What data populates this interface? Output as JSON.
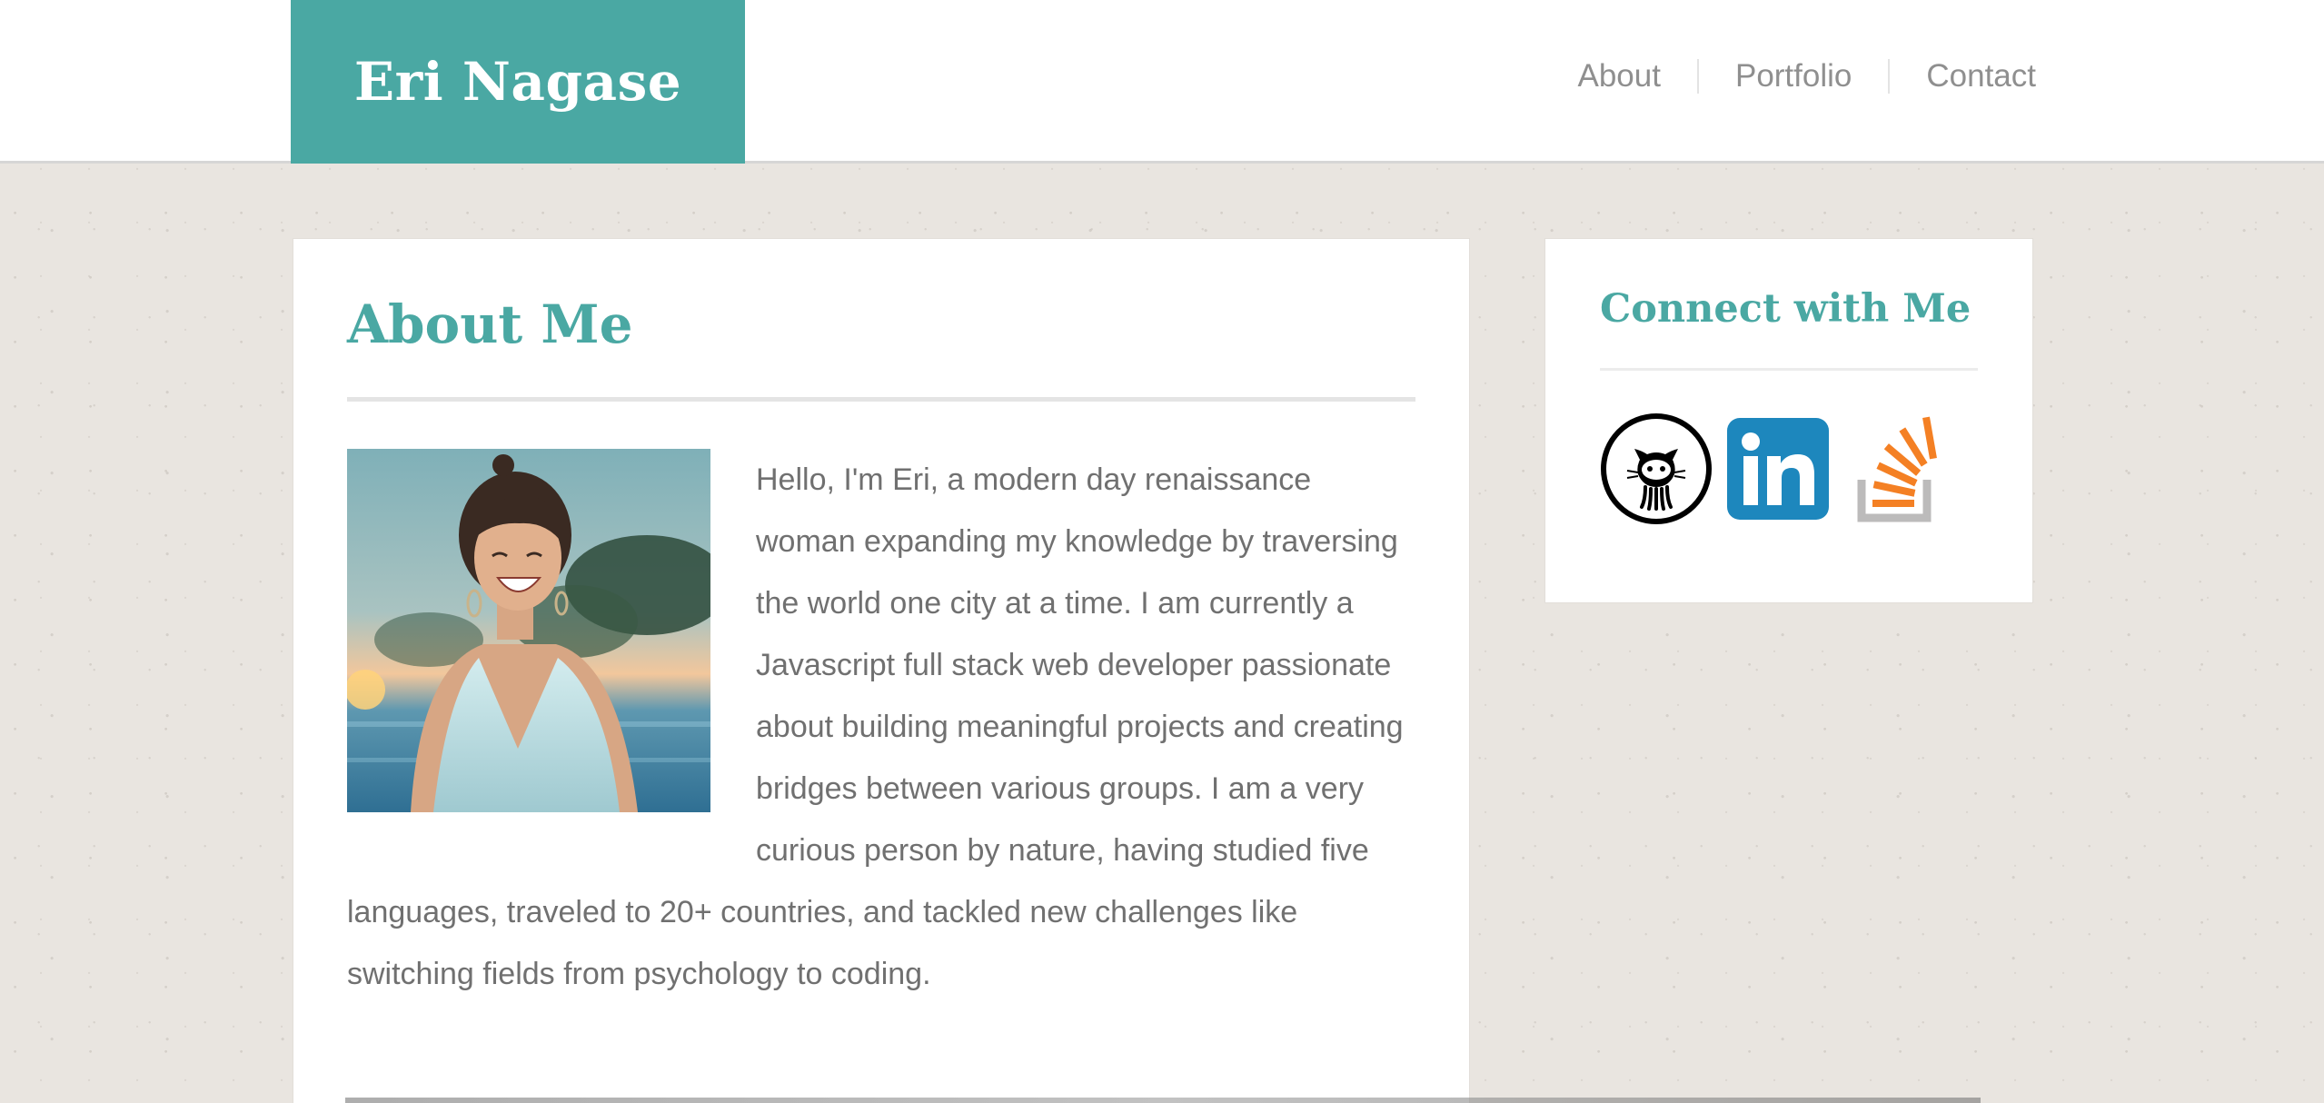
{
  "header": {
    "brand": "Eri Nagase",
    "nav": [
      {
        "label": "About"
      },
      {
        "label": "Portfolio"
      },
      {
        "label": "Contact"
      }
    ]
  },
  "about": {
    "title": "About Me",
    "photo_alt": "Portrait of Eri laughing by the sea",
    "text": "Hello, I'm Eri, a modern day renaissance woman expanding my knowledge by traversing the world one city at a time. I am currently a Javascript full stack web developer passionate about building meaningful projects and creating bridges between various groups. I am a very curious person by nature, having studied five languages, traveled to 20+ countries, and tackled new challenges like switching fields from psychology to coding."
  },
  "sidebar": {
    "title": "Connect with Me",
    "social": [
      {
        "icon": "github-icon"
      },
      {
        "icon": "linkedin-icon"
      },
      {
        "icon": "stackoverflow-icon"
      }
    ]
  },
  "colors": {
    "accent": "#4aa8a3",
    "text": "#707070",
    "nav_text": "#8f8f8f",
    "linkedin": "#1d87bd",
    "stackoverflow": "#f48024"
  }
}
